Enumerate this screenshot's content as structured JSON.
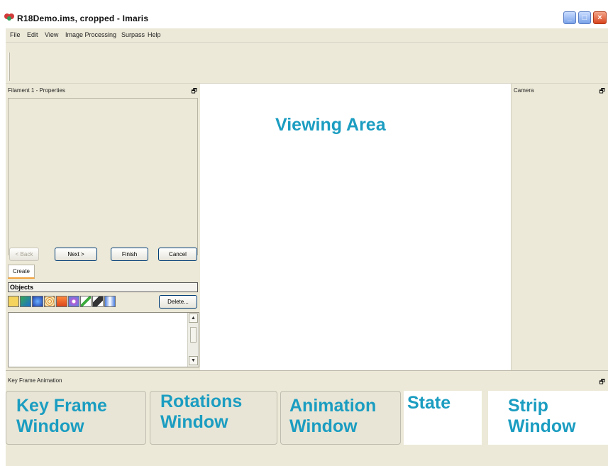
{
  "window": {
    "title": "R18Demo.ims, cropped  - Imaris",
    "buttons": [
      "_",
      "□",
      "×"
    ]
  },
  "menu": [
    "File",
    "Edit",
    "View",
    "Image Processing",
    "Surpass",
    "Help"
  ],
  "left_panel": {
    "header": "Filament 1 - Properties",
    "pin": "🗗",
    "wizard_buttons": {
      "back": "< Back",
      "next": "Next >",
      "finish": "Finish",
      "cancel": "Cancel"
    },
    "create_tab": "Create",
    "objects_header": "Objects",
    "object_icons": [
      "new-folder-icon",
      "volume-icon",
      "surfaces-icon",
      "spots-icon",
      "measurement-points-icon",
      "cells-icon",
      "filaments-icon",
      "clipping-plane-icon",
      "reference-frame-icon"
    ],
    "delete_button": "Delete..."
  },
  "viewing_area": {
    "label": "Viewing Area"
  },
  "camera_panel": {
    "header": "Camera",
    "pin": "🗗"
  },
  "key_frame": {
    "header": "Key Frame Animation",
    "pin": "🗗",
    "boxes": [
      {
        "line1": "Key Frame",
        "line2": "Window"
      },
      {
        "line1": "Rotations",
        "line2": "Window"
      },
      {
        "line1": "Animation",
        "line2": "Window"
      },
      {
        "line1": "State",
        "line2": ""
      },
      {
        "line1": "Strip",
        "line2": "Window"
      }
    ]
  },
  "colors": {
    "accent_label": "#1b9dc1",
    "panel_bg": "#ece9d8",
    "create_tab_underline": "#f2a23b"
  }
}
